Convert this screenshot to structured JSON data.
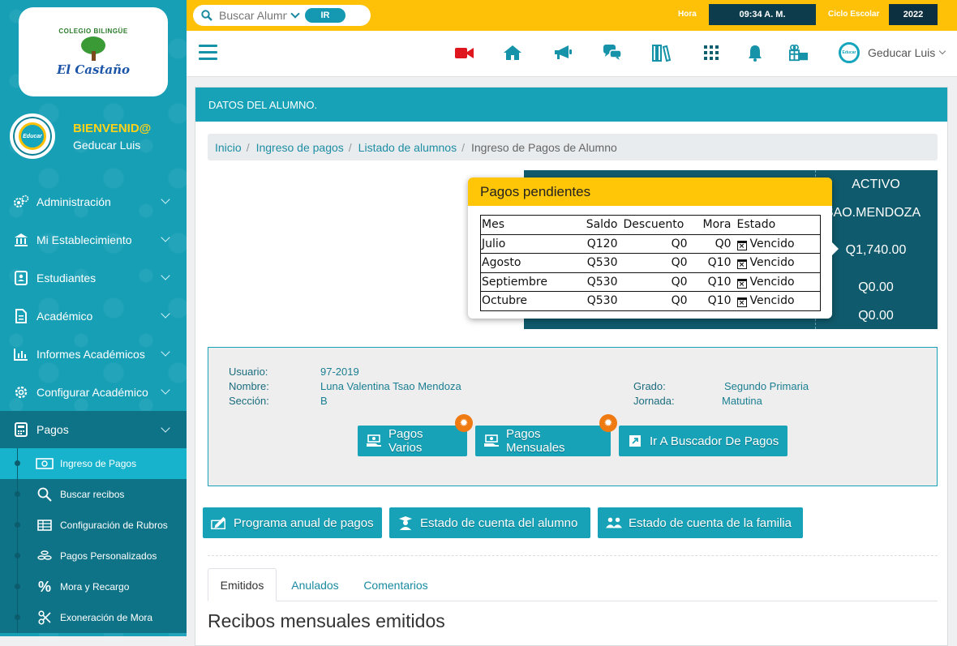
{
  "sidebar": {
    "logo": {
      "arc": "COLEGIO BILINGÜE",
      "name": "El Castaño"
    },
    "avatar_text": "Educar",
    "welcome": "BIENVENID@",
    "user": "Geducar Luis",
    "menu": [
      {
        "label": "Administración",
        "icon": "gears-icon"
      },
      {
        "label": "Mi Establecimiento",
        "icon": "bank-icon"
      },
      {
        "label": "Estudiantes",
        "icon": "id-card-icon"
      },
      {
        "label": "Académico",
        "icon": "document-icon"
      },
      {
        "label": "Informes Académicos",
        "icon": "bar-chart-icon"
      },
      {
        "label": "Configurar Académico",
        "icon": "gear-icon"
      },
      {
        "label": "Pagos",
        "icon": "calculator-icon"
      }
    ],
    "submenu": [
      {
        "label": "Ingreso de Pagos",
        "icon": "money-icon"
      },
      {
        "label": "Buscar recibos",
        "icon": "search-icon"
      },
      {
        "label": "Configuración de Rubros",
        "icon": "table-icon"
      },
      {
        "label": "Pagos Personalizados",
        "icon": "coins-icon"
      },
      {
        "label": "Mora y Recargo",
        "icon": "percent-icon"
      },
      {
        "label": "Exoneración de Mora",
        "icon": "scissors-icon"
      }
    ]
  },
  "topbar": {
    "search_placeholder": "Buscar Alumno",
    "search_button": "IR",
    "hora_label": "Hora",
    "hora_value": "09:34 A. M.",
    "ciclo_label": "Ciclo Escolar",
    "ciclo_value": "2022"
  },
  "navbar": {
    "user_name": "Geducar Luis",
    "user_avatar_text": "Educar",
    "icons": [
      "video-icon",
      "home-icon",
      "megaphone-icon",
      "chat-icon",
      "books-icon",
      "apps-grid-icon",
      "bell-icon",
      "gifts-icon"
    ],
    "colors": {
      "video": "#e0161e",
      "accent": "#17a2b8",
      "topbar": "#ffc107"
    }
  },
  "card": {
    "title": "DATOS DEL ALUMNO.",
    "breadcrumb": [
      "Inicio",
      "Ingreso de pagos",
      "Listado de alumnos",
      "Ingreso de Pagos de Alumno"
    ],
    "status_panel": {
      "estado": "ACTIVO",
      "apellido": "SAO.MENDOZA",
      "total": "Q1,740.00",
      "val2": "Q0.00",
      "val3": "Q0.00"
    },
    "popover": {
      "title": "Pagos pendientes",
      "columns": [
        "Mes",
        "Saldo",
        "Descuento",
        "Mora",
        "Estado"
      ],
      "rows": [
        {
          "mes": "Julio",
          "saldo": "Q120",
          "descuento": "Q0",
          "mora": "Q0",
          "estado": "Vencido"
        },
        {
          "mes": "Agosto",
          "saldo": "Q530",
          "descuento": "Q0",
          "mora": "Q10",
          "estado": "Vencido"
        },
        {
          "mes": "Septiembre",
          "saldo": "Q530",
          "descuento": "Q0",
          "mora": "Q10",
          "estado": "Vencido"
        },
        {
          "mes": "Octubre",
          "saldo": "Q530",
          "descuento": "Q0",
          "mora": "Q10",
          "estado": "Vencido"
        }
      ]
    },
    "student": {
      "usuario_label": "Usuario:",
      "usuario": "97-2019",
      "nombre_label": "Nombre:",
      "nombre": "Luna Valentina Tsao Mendoza",
      "seccion_label": "Sección:",
      "seccion": "B",
      "grado_label": "Grado:",
      "grado": "Segundo Primaria",
      "jornada_label": "Jornada:",
      "jornada": "Matutina"
    },
    "actions": {
      "pagos_varios": "Pagos Varios",
      "pagos_mensuales": "Pagos Mensuales",
      "buscador": "Ir A Buscador De Pagos"
    },
    "reports": {
      "programa": "Programa anual de pagos",
      "estado_alumno": "Estado de cuenta del alumno",
      "estado_familia": "Estado de cuenta de la familia"
    },
    "tabs": [
      "Emitidos",
      "Anulados",
      "Comentarios"
    ],
    "section_title": "Recibos mensuales emitidos"
  }
}
